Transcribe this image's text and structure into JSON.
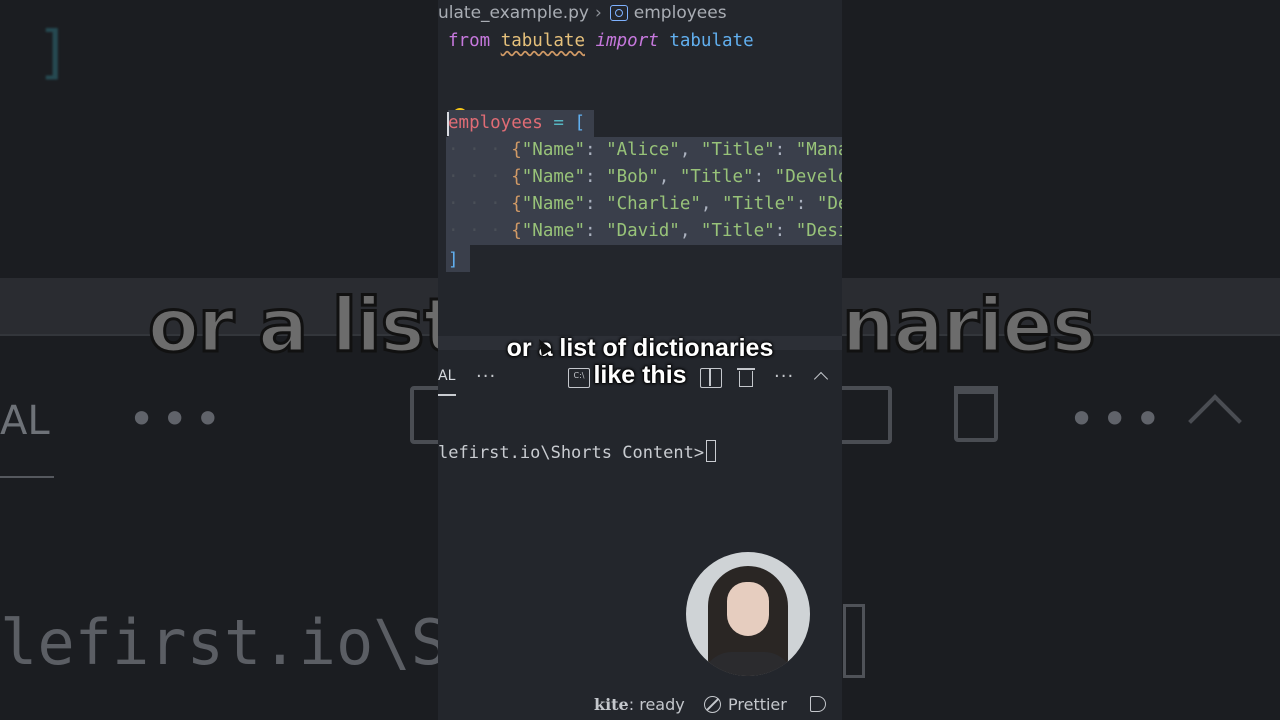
{
  "editor": {
    "breadcrumb": {
      "file": "ulate_example.py",
      "symbol": "employees"
    },
    "code": {
      "import_line": {
        "from": "from",
        "module": "tabulate",
        "import": "import",
        "name": "tabulate"
      },
      "assign": {
        "var": "employees",
        "op": " = ",
        "open": "["
      },
      "rows": [
        {
          "indent": "· · · ",
          "text_start": "{",
          "k1": "\"Name\"",
          "colon1": ": ",
          "v1": "\"Alice\"",
          "comma1": ", ",
          "k2": "\"Title\"",
          "colon2": ": ",
          "v2": "\"Mana"
        },
        {
          "indent": "· · · ",
          "text_start": "{",
          "k1": "\"Name\"",
          "colon1": ": ",
          "v1": "\"Bob\"",
          "comma1": ", ",
          "k2": "\"Title\"",
          "colon2": ": ",
          "v2": "\"Develo"
        },
        {
          "indent": "· · · ",
          "text_start": "{",
          "k1": "\"Name\"",
          "colon1": ": ",
          "v1": "\"Charlie\"",
          "comma1": ", ",
          "k2": "\"Title\"",
          "colon2": ": ",
          "v2": "\"De"
        },
        {
          "indent": "· · · ",
          "text_start": "{",
          "k1": "\"Name\"",
          "colon1": ": ",
          "v1": "\"David\"",
          "comma1": ", ",
          "k2": "\"Title\"",
          "colon2": ": ",
          "v2": "\"Desi"
        }
      ],
      "close": "]"
    }
  },
  "terminal": {
    "tab_label": "AL",
    "more": "···",
    "prompt_path": "lefirst.io\\Shorts Content>",
    "cmd_icon_text": "C:\\"
  },
  "caption": {
    "line1": "or a list of dictionaries",
    "line2": "like this"
  },
  "background": {
    "caption_left": "or a list",
    "caption_right": "naries",
    "tab_label": "AL",
    "path": "lefirst.io\\Sho"
  },
  "statusbar": {
    "kite_brand": "kite",
    "kite_status": ": ready",
    "prettier": "Prettier"
  }
}
